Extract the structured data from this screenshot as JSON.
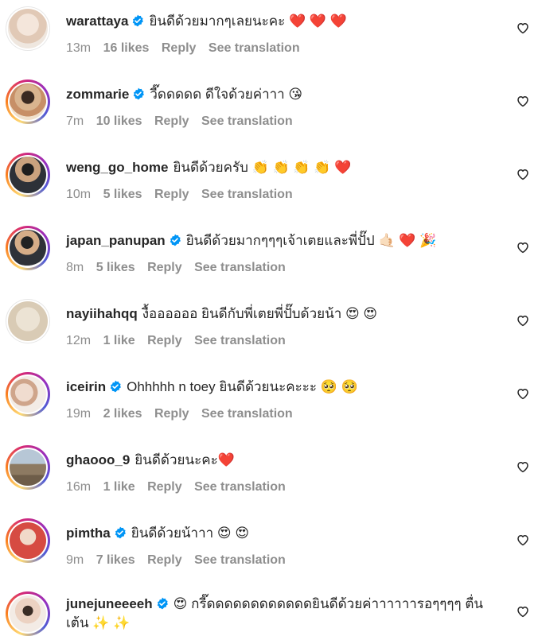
{
  "labels": {
    "reply": "Reply",
    "see_translation": "See translation"
  },
  "colors": {
    "verified": "#0095f6",
    "meta_text": "#8e8e8e",
    "text": "#262626"
  },
  "comments": [
    {
      "username": "warattaya",
      "verified": true,
      "text": "ยินดีด้วยมากๆเลยนะคะ ❤️ ❤️ ❤️",
      "time": "13m",
      "likes": "16 likes",
      "story_ring": false,
      "avatar_color": "#e9d7c9"
    },
    {
      "username": "zommarie",
      "verified": true,
      "text": "วี๊ดดดดด ดีใจด้วยค่าาา 😘",
      "time": "7m",
      "likes": "10 likes",
      "story_ring": true,
      "avatar_color": "#d8b08c"
    },
    {
      "username": "weng_go_home",
      "verified": false,
      "text": "ยินดีด้วยครับ 👏 👏 👏 👏 ❤️",
      "time": "10m",
      "likes": "5 likes",
      "story_ring": true,
      "avatar_color": "#4a4f57"
    },
    {
      "username": "japan_panupan",
      "verified": true,
      "text": "ยินดีด้วยมากๆๆๆเจ้าเตยและพี่ปั๊ป 🤙🏻 ❤️ 🎉",
      "time": "8m",
      "likes": "5 likes",
      "story_ring": true,
      "avatar_color": "#3b3f46"
    },
    {
      "username": "nayiihahqq",
      "verified": false,
      "text": "งื้ออออออ ยินดีกับพี่เตยพี่ปั๊บด้วยน้า 😍 😍",
      "time": "12m",
      "likes": "1 like",
      "story_ring": false,
      "avatar_color": "#d9cbb5"
    },
    {
      "username": "iceirin",
      "verified": true,
      "text": "Ohhhhh n toey ยินดีด้วยนะคะะะ 🥺 🥺",
      "time": "19m",
      "likes": "2 likes",
      "story_ring": true,
      "avatar_color": "#e8d4c6"
    },
    {
      "username": "ghaooo_9",
      "verified": false,
      "text": "ยินดีด้วยนะคะ❤️",
      "time": "16m",
      "likes": "1 like",
      "story_ring": true,
      "avatar_color": "#9a8a73"
    },
    {
      "username": "pimtha",
      "verified": true,
      "text": "ยินดีด้วยน้าาา 😍 😍",
      "time": "9m",
      "likes": "7 likes",
      "story_ring": true,
      "avatar_color": "#c9433f"
    },
    {
      "username": "junejuneeeeh",
      "verified": true,
      "text": "😍 กรี๊ดดดดดดดดดดดดยินดีด้วยค่าาาาาารอๆๆๆๆ ตื่นเต้น ✨ ✨",
      "time": "",
      "likes": "",
      "story_ring": true,
      "avatar_color": "#e3cfc2"
    }
  ]
}
